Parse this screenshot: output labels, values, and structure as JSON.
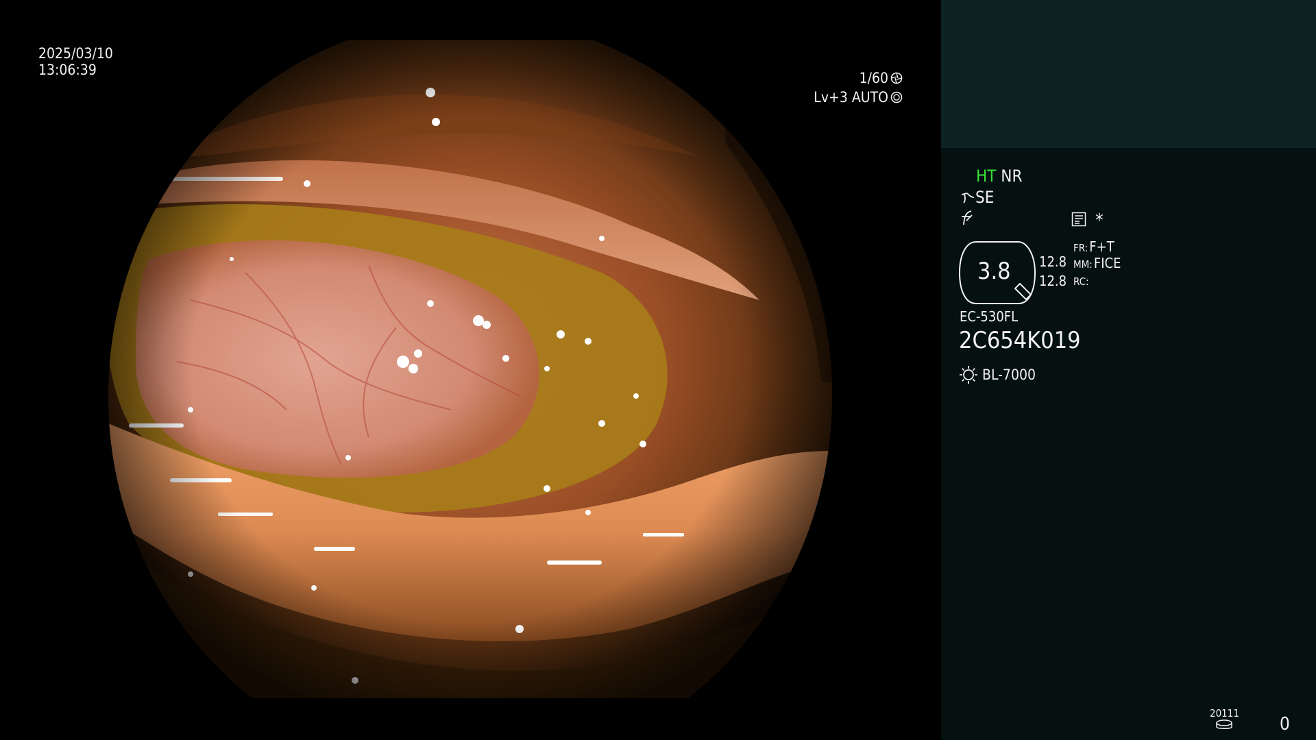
{
  "date": "2025/03/10",
  "time": "13:06:39",
  "shutter": "1/60",
  "level": "Lv+3 AUTO",
  "icons": {
    "shutter": "shutter-aperture-icon",
    "iris": "iris-auto-icon",
    "scope_bend": "scope-bend-icon",
    "frequency": "hf-symbol-icon",
    "memory": "memory-list-icon",
    "asterisk": "asterisk-icon",
    "light": "light-source-icon",
    "storage": "storage-disk-icon"
  },
  "panel": {
    "ht": "HT",
    "nr": "NR",
    "se": "SE",
    "asterisk": "*",
    "magnification": "3.8",
    "value1": "12.8",
    "value2": "12.8",
    "fr_label": "FR:",
    "fr_value": "F+T",
    "mm_label": "MM:",
    "mm_value": "FICE",
    "rc_label": "RC:",
    "scope_model": "EC-530FL",
    "serial": "2C654K019",
    "light_source": "BL-7000",
    "counter_label": "20111",
    "counter_value": "0"
  },
  "colors": {
    "panel_top": "#0c2223",
    "panel_body": "#051010",
    "ht_green": "#38e03a"
  }
}
